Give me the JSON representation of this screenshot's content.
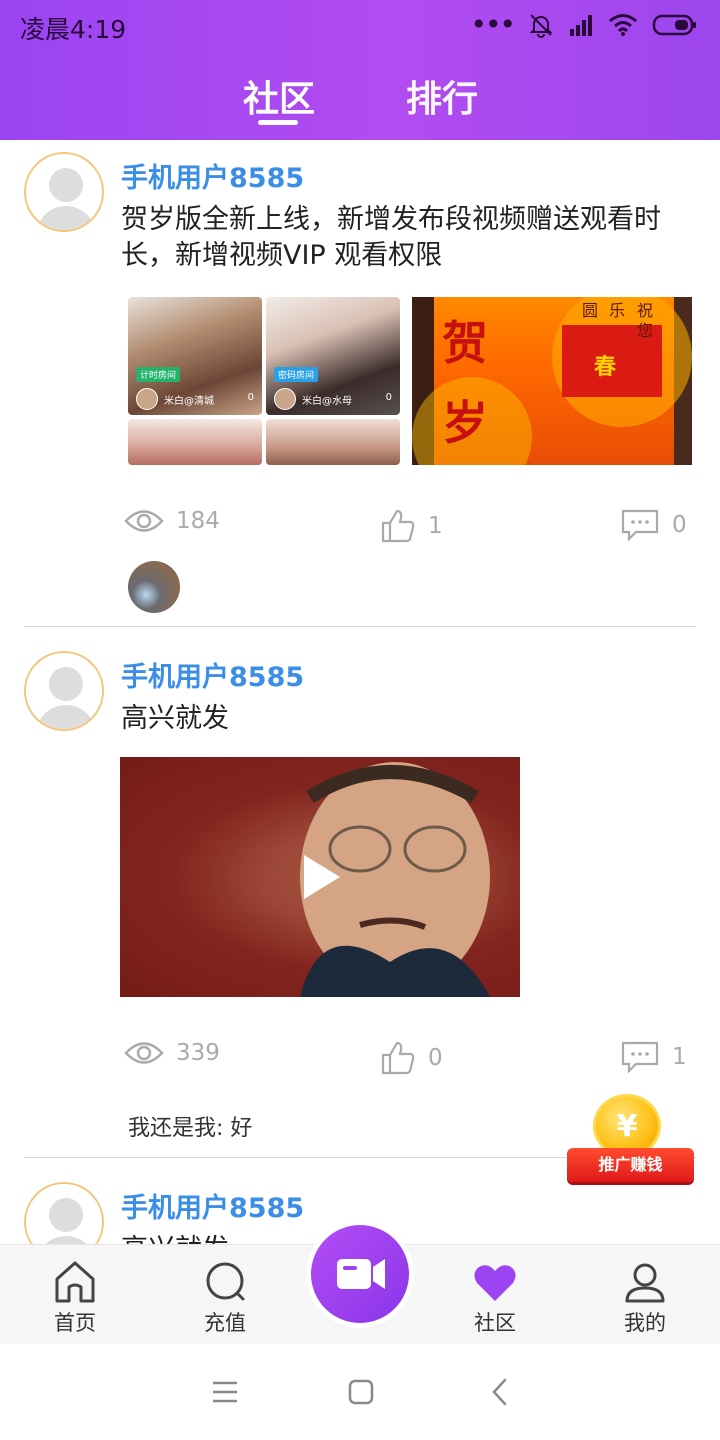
{
  "status_bar": {
    "time": "凌晨4:19",
    "icons": [
      "more-dots-icon",
      "bell-off-icon",
      "signal-icon",
      "wifi-icon",
      "battery-icon"
    ]
  },
  "header": {
    "tabs": [
      {
        "label": "社区",
        "active": true
      },
      {
        "label": "排行",
        "active": false
      }
    ],
    "accent_color": "#9b44f2"
  },
  "posts": [
    {
      "username": "手机用户8585",
      "text": "贺岁版全新上线，新增发布段视频赠送观看时长，新增视频VIP 观看权限",
      "collage": {
        "tiles": [
          {
            "tag": "计时房间",
            "name": "米白@清城",
            "count": "0"
          },
          {
            "tag": "密码房间",
            "name": "米白@水母",
            "count": "0"
          }
        ]
      },
      "banner_text": [
        "贺",
        "岁",
        "圆",
        "乐",
        "祝",
        "您",
        "春"
      ],
      "stats": {
        "views": "184",
        "likes": "1",
        "comments": "0"
      }
    },
    {
      "username": "手机用户8585",
      "text": "高兴就发",
      "stats": {
        "views": "339",
        "likes": "0",
        "comments": "1"
      },
      "comment": {
        "author": "我还是我:",
        "text": "好"
      }
    },
    {
      "username": "手机用户8585",
      "text": "高兴就发"
    }
  ],
  "promo": {
    "label": "推广赚钱",
    "coin_symbol": "¥"
  },
  "bottom_nav": [
    {
      "label": "首页",
      "icon": "home-icon"
    },
    {
      "label": "充值",
      "icon": "search-icon"
    },
    {
      "label": "",
      "icon": "video-camera-icon"
    },
    {
      "label": "社区",
      "icon": "heart-icon"
    },
    {
      "label": "我的",
      "icon": "user-icon"
    }
  ],
  "system_nav": [
    "menu-icon",
    "home-square-icon",
    "back-icon"
  ]
}
